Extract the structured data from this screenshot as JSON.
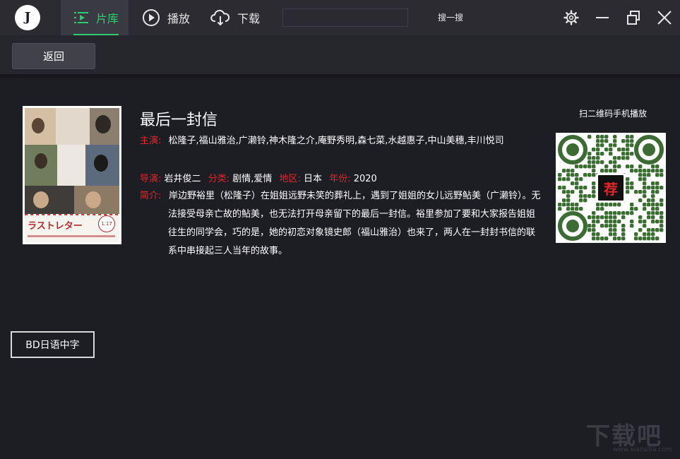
{
  "header": {
    "logo_text": "J",
    "nav": [
      {
        "label": "片库",
        "icon": "library-icon",
        "active": true
      },
      {
        "label": "播放",
        "icon": "play-icon",
        "active": false
      },
      {
        "label": "下载",
        "icon": "download-icon",
        "active": false
      }
    ],
    "search_value": "",
    "search_button": "搜一搜",
    "window_controls": [
      "gear-icon",
      "minimize-icon",
      "restore-icon",
      "close-icon"
    ]
  },
  "toolbar": {
    "back_label": "返回"
  },
  "movie": {
    "title": "最后一封信",
    "cast_label": "主演:",
    "cast": "松隆子,福山雅治,广濑铃,神木隆之介,庵野秀明,森七菜,水越惠子,中山美穗,丰川悦司",
    "director_label": "导演:",
    "director": "岩井俊二",
    "genre_label": "分类:",
    "genre": "剧情,爱情",
    "region_label": "地区:",
    "region": "日本",
    "year_label": "年份:",
    "year": "2020",
    "synopsis_label": "简介:",
    "synopsis": "岸边野裕里（松隆子）在姐姐远野未笑的葬礼上，遇到了姐姐的女儿远野鲇美（广濑铃）。无法接受母亲亡故的鲇美，也无法打开母亲留下的最后一封信。裕里参加了要和大家报告姐姐往生的同学会，巧的是，她的初恋对象镜史郎（福山雅治）也来了，两人在一封封书信的联系中串接起三人当年的故事。",
    "poster_title": "ラストレター",
    "poster_date": "1.17",
    "qr_label": "扫二维码手机播放",
    "qr_center_char": "荐"
  },
  "source_button": "BD日语中字",
  "watermark": {
    "text": "下载吧",
    "sub": "www.xiazaiba.com"
  },
  "colors": {
    "accent": "#2ecc71",
    "label_red": "#e0262d",
    "qr_green": "#3d6b34",
    "background": "#1d1d24"
  }
}
